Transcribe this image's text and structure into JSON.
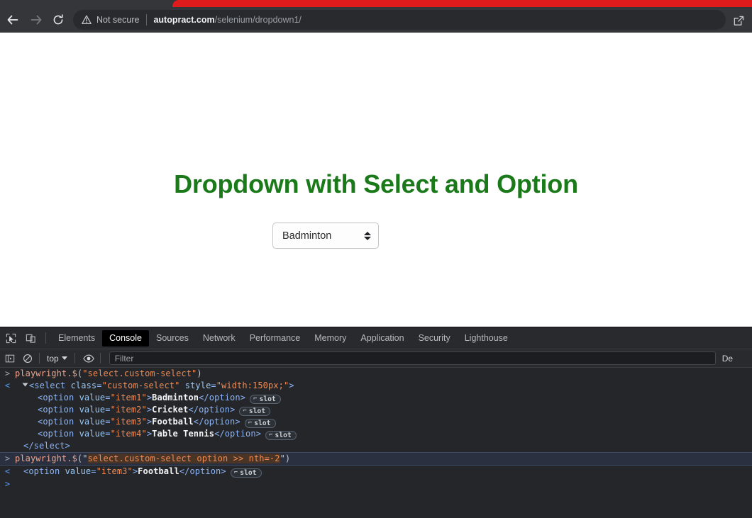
{
  "browser": {
    "back_label": "back-arrow",
    "forward_label": "forward-arrow",
    "reload_label": "reload",
    "security_text": "Not secure",
    "url_host": "autopract.com",
    "url_path": "/selenium/dropdown1/",
    "share_label": "share",
    "tab_accent_color": "#e01b1b"
  },
  "page": {
    "heading": "Dropdown with Select and Option",
    "heading_color": "#1a7a1a",
    "select": {
      "value": "Badminton",
      "options": [
        "Badminton",
        "Cricket",
        "Football",
        "Table Tennis"
      ],
      "width_style": "width:150px;",
      "class": "custom-select"
    }
  },
  "devtools": {
    "tabs": [
      {
        "label": "Elements",
        "active": false
      },
      {
        "label": "Console",
        "active": true
      },
      {
        "label": "Sources",
        "active": false
      },
      {
        "label": "Network",
        "active": false
      },
      {
        "label": "Performance",
        "active": false
      },
      {
        "label": "Memory",
        "active": false
      },
      {
        "label": "Application",
        "active": false
      },
      {
        "label": "Security",
        "active": false
      },
      {
        "label": "Lighthouse",
        "active": false
      }
    ],
    "toolbar": {
      "inspect_icon": "inspect-element-icon",
      "device_icon": "device-toolbar-icon",
      "sidebar_icon": "console-sidebar-icon",
      "clear_icon": "clear-console-icon",
      "context": "top",
      "eye_icon": "live-expression-icon",
      "filter_placeholder": "Filter",
      "levels_label": "De"
    },
    "console": {
      "entries": [
        {
          "type": "input",
          "gutter": ">",
          "fn": "playwright.$",
          "arg": "\"select.custom-select\"",
          "selected": false
        },
        {
          "type": "output",
          "gutter": "<",
          "node_open_tag": "select",
          "node_attrs": [
            {
              "name": "class",
              "value": "\"custom-select\""
            },
            {
              "name": "style",
              "value": "\"width:150px;\""
            }
          ],
          "children": [
            {
              "tag": "option",
              "attr_name": "value",
              "attr_value": "\"item1\"",
              "text": "Badminton",
              "badge": "slot"
            },
            {
              "tag": "option",
              "attr_name": "value",
              "attr_value": "\"item2\"",
              "text": "Cricket",
              "badge": "slot"
            },
            {
              "tag": "option",
              "attr_name": "value",
              "attr_value": "\"item3\"",
              "text": "Football",
              "badge": "slot"
            },
            {
              "tag": "option",
              "attr_name": "value",
              "attr_value": "\"item4\"",
              "text": "Table Tennis",
              "badge": "slot"
            }
          ],
          "close_tag": "</select>"
        },
        {
          "type": "input",
          "gutter": ">",
          "fn": "playwright.$",
          "arg": "\"select.custom-select option >> nth=-2\"",
          "arg_inner": "select.custom-select option >> nth=-2",
          "selected": true
        },
        {
          "type": "output",
          "gutter": "<",
          "single_node": {
            "tag": "option",
            "attr_name": "value",
            "attr_value": "\"item3\"",
            "text": "Football",
            "badge": "slot"
          }
        }
      ],
      "prompt_caret": ">"
    }
  }
}
